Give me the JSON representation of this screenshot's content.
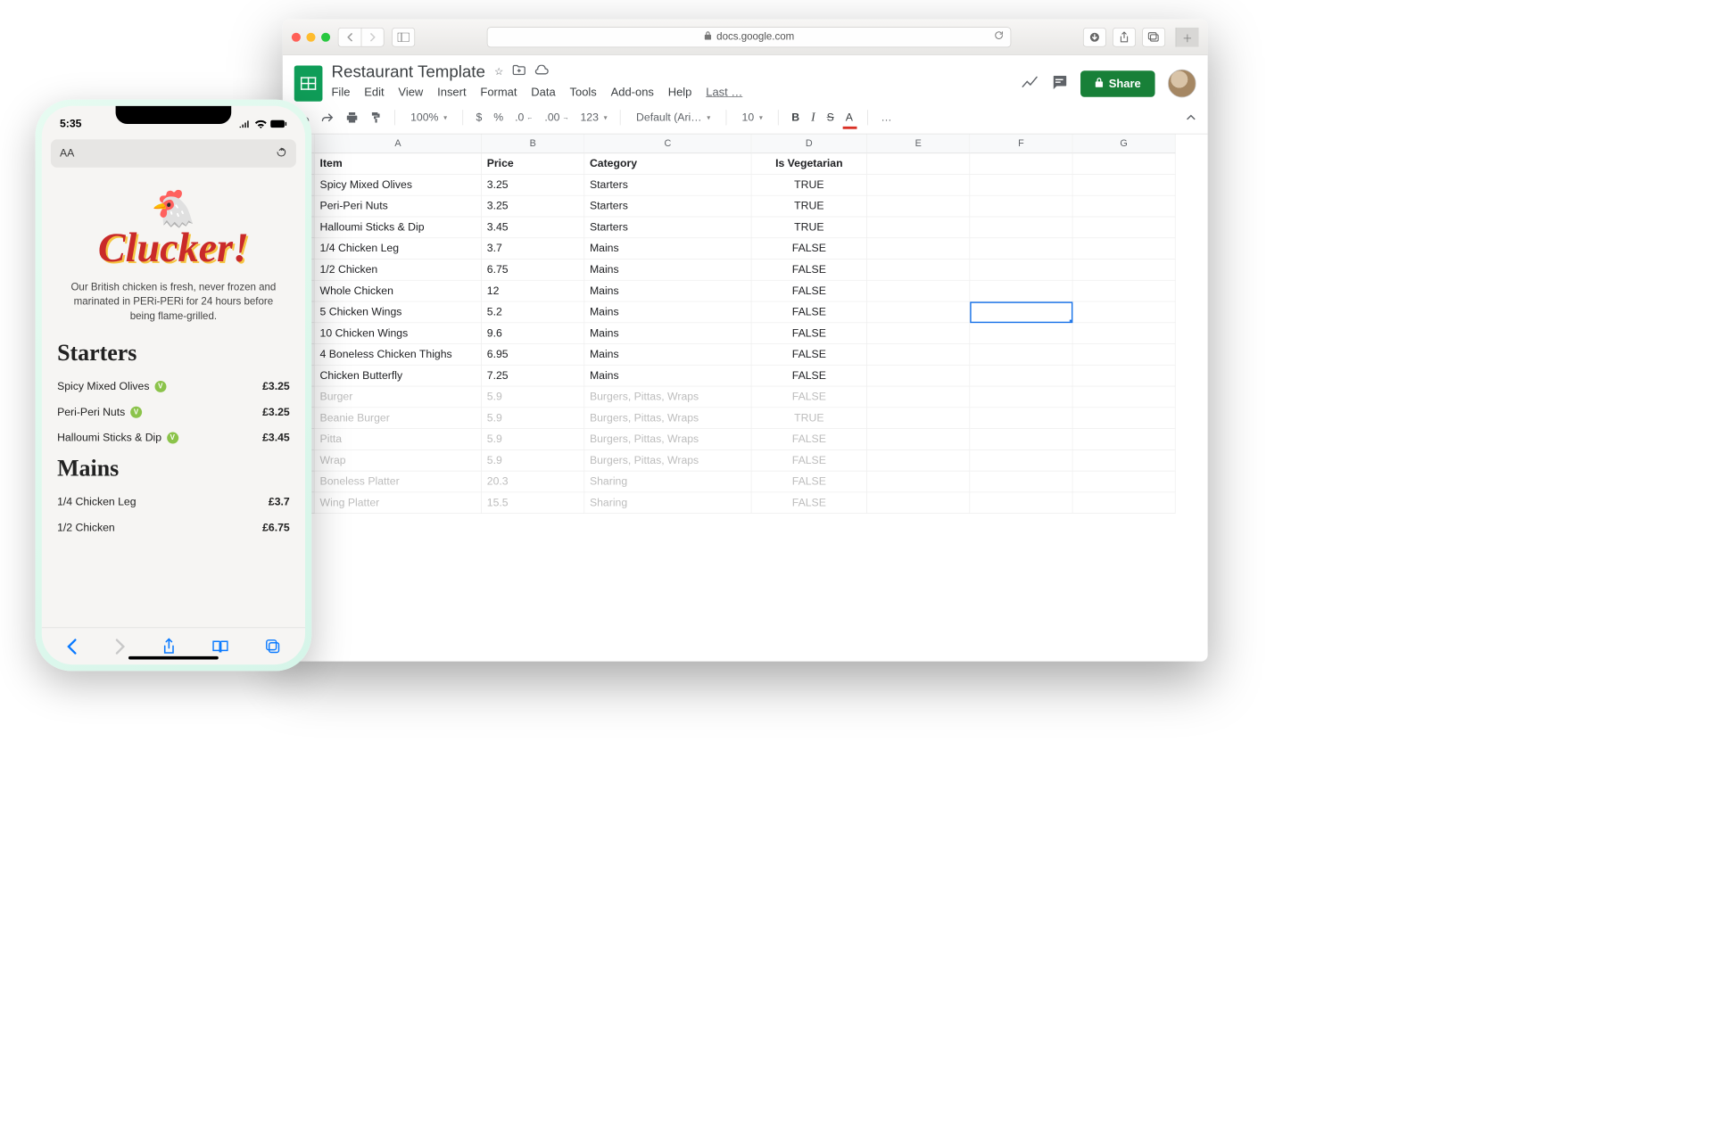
{
  "phone": {
    "time": "5:35",
    "urlbar_left": "AA",
    "brand": "Clucker!",
    "intro": "Our British chicken is fresh, never frozen and marinated in PERi-PERi for 24 hours before being flame-grilled.",
    "sections": [
      {
        "title": "Starters",
        "items": [
          {
            "name": "Spicy Mixed Olives",
            "price": "£3.25",
            "veg": true
          },
          {
            "name": "Peri-Peri Nuts",
            "price": "£3.25",
            "veg": true
          },
          {
            "name": "Halloumi Sticks & Dip",
            "price": "£3.45",
            "veg": true
          }
        ]
      },
      {
        "title": "Mains",
        "items": [
          {
            "name": "1/4 Chicken Leg",
            "price": "£3.7",
            "veg": false
          },
          {
            "name": "1/2 Chicken",
            "price": "£6.75",
            "veg": false
          }
        ]
      }
    ]
  },
  "browser": {
    "url_host": "docs.google.com"
  },
  "sheets": {
    "title": "Restaurant Template",
    "menus": [
      "File",
      "Edit",
      "View",
      "Insert",
      "Format",
      "Data",
      "Tools",
      "Add-ons",
      "Help"
    ],
    "last_label": "Last …",
    "share_label": "Share",
    "toolbar": {
      "zoom": "100%",
      "currency": "$",
      "percent": "%",
      "dec_dec": ".0",
      "dec_inc": ".00",
      "numfmt": "123",
      "font": "Default (Ari…",
      "size": "10",
      "bold": "B",
      "italic": "I",
      "strike": "S",
      "textcolor": "A",
      "more": "…"
    },
    "columns": [
      "A",
      "B",
      "C",
      "D",
      "E",
      "F",
      "G"
    ],
    "header_row": [
      "Item",
      "Price",
      "Category",
      "Is Vegetarian"
    ],
    "rows": [
      {
        "item": "Spicy Mixed Olives",
        "price": "3.25",
        "category": "Starters",
        "veg": "TRUE",
        "faded": false
      },
      {
        "item": "Peri-Peri Nuts",
        "price": "3.25",
        "category": "Starters",
        "veg": "TRUE",
        "faded": false
      },
      {
        "item": "Halloumi Sticks & Dip",
        "price": "3.45",
        "category": "Starters",
        "veg": "TRUE",
        "faded": false
      },
      {
        "item": "1/4 Chicken Leg",
        "price": "3.7",
        "category": "Mains",
        "veg": "FALSE",
        "faded": false
      },
      {
        "item": "1/2 Chicken",
        "price": "6.75",
        "category": "Mains",
        "veg": "FALSE",
        "faded": false
      },
      {
        "item": "Whole Chicken",
        "price": "12",
        "category": "Mains",
        "veg": "FALSE",
        "faded": false
      },
      {
        "item": "5 Chicken Wings",
        "price": "5.2",
        "category": "Mains",
        "veg": "FALSE",
        "faded": false
      },
      {
        "item": "10 Chicken Wings",
        "price": "9.6",
        "category": "Mains",
        "veg": "FALSE",
        "faded": false
      },
      {
        "item": "4 Boneless Chicken Thighs",
        "price": "6.95",
        "category": "Mains",
        "veg": "FALSE",
        "faded": false
      },
      {
        "item": "Chicken Butterfly",
        "price": "7.25",
        "category": "Mains",
        "veg": "FALSE",
        "faded": false
      },
      {
        "item": "Burger",
        "price": "5.9",
        "category": "Burgers, Pittas, Wraps",
        "veg": "FALSE",
        "faded": true
      },
      {
        "item": "Beanie Burger",
        "price": "5.9",
        "category": "Burgers, Pittas, Wraps",
        "veg": "TRUE",
        "faded": true
      },
      {
        "item": "Pitta",
        "price": "5.9",
        "category": "Burgers, Pittas, Wraps",
        "veg": "FALSE",
        "faded": true
      },
      {
        "item": "Wrap",
        "price": "5.9",
        "category": "Burgers, Pittas, Wraps",
        "veg": "FALSE",
        "faded": true
      },
      {
        "item": "Boneless Platter",
        "price": "20.3",
        "category": "Sharing",
        "veg": "FALSE",
        "faded": true
      },
      {
        "item": "Wing Platter",
        "price": "15.5",
        "category": "Sharing",
        "veg": "FALSE",
        "faded": true
      }
    ],
    "selected_cell": "F8"
  }
}
